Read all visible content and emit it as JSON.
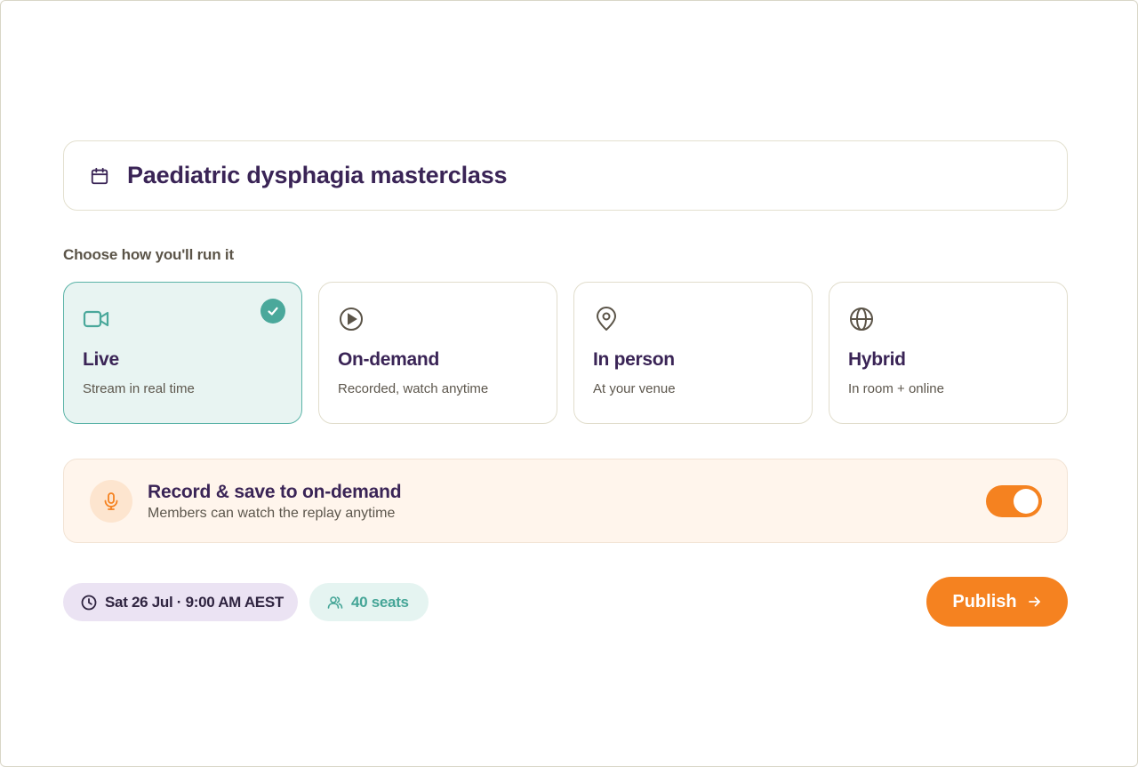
{
  "event": {
    "title": "Paediatric dysphagia masterclass",
    "title_icon": "calendar-icon"
  },
  "format": {
    "label": "Choose how you'll run it",
    "selected": "live",
    "options": [
      {
        "id": "live",
        "icon": "video-camera-icon",
        "name": "Live",
        "desc": "Stream in real time",
        "selected": true
      },
      {
        "id": "on-demand",
        "icon": "play-circle-icon",
        "name": "On-demand",
        "desc": "Recorded, watch anytime",
        "selected": false
      },
      {
        "id": "in-person",
        "icon": "map-pin-icon",
        "name": "In person",
        "desc": "At your venue",
        "selected": false
      },
      {
        "id": "hybrid",
        "icon": "globe-icon",
        "name": "Hybrid",
        "desc": "In room + online",
        "selected": false
      }
    ]
  },
  "record": {
    "icon": "microphone-icon",
    "title": "Record & save to on-demand",
    "subtitle": "Members can watch the replay anytime",
    "enabled": true
  },
  "meta": {
    "date_icon": "clock-icon",
    "date": "Sat 26 Jul · 9:00 AM AEST",
    "seats_icon": "users-icon",
    "seats": "40 seats"
  },
  "actions": {
    "publish_label": "Publish",
    "publish_icon": "arrow-right-icon"
  },
  "colors": {
    "primary_text": "#3a2456",
    "accent_teal": "#4aa89b",
    "accent_orange": "#f58220",
    "selected_bg": "#e8f4f2",
    "record_bg": "#fff5ec",
    "date_pill_bg": "#ebe3f3",
    "seats_pill_bg": "#e5f4f1"
  }
}
